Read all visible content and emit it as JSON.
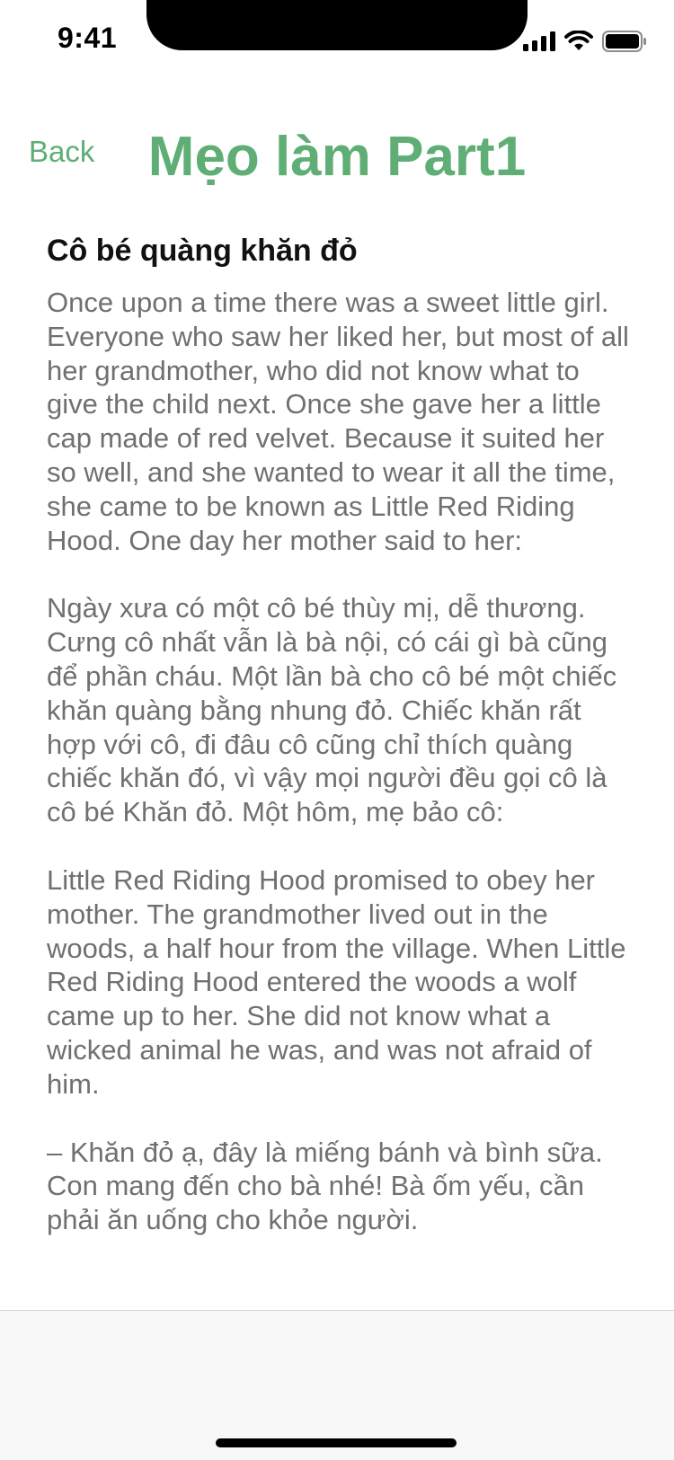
{
  "status_bar": {
    "time": "9:41",
    "icons": [
      "signal-icon",
      "wifi-icon",
      "battery-icon"
    ]
  },
  "header": {
    "back_label": "Back",
    "title": "Mẹo làm Part1"
  },
  "colors": {
    "accent": "#5fae75",
    "body_text": "#707070",
    "heading_text": "#111111"
  },
  "story": {
    "heading": "Cô bé quàng khăn đỏ",
    "paragraphs": [
      "Once upon a time there was a sweet little girl. Everyone who saw her liked her, but most of all her grandmother, who did not know what to give the child next. Once she gave her a little cap made of red velvet. Because it suited her so well, and she wanted to wear it all the time, she came to be known as Little Red Riding Hood. One day her mother said to her:",
      "Ngày xưa có một cô bé thùy mị, dễ thương. Cưng cô nhất vẫn là bà nội, có cái gì bà cũng để phần cháu. Một lần bà cho cô bé một chiếc khăn quàng bằng nhung đỏ. Chiếc khăn rất hợp với cô, đi đâu cô cũng chỉ thích quàng chiếc khăn đó, vì vậy mọi người đều gọi cô là cô bé Khăn đỏ. Một hôm, mẹ bảo cô:",
      "Little Red Riding Hood promised to obey her mother. The grandmother lived out in the woods, a half hour from the village. When Little Red Riding Hood entered the woods a wolf came up to her. She did not know what a wicked animal he was, and was not afraid of him.",
      "– Khăn đỏ ạ, đây là miếng bánh và bình sữa. Con mang đến cho bà nhé! Bà ốm yếu, cần phải ăn uống cho khỏe người."
    ]
  }
}
